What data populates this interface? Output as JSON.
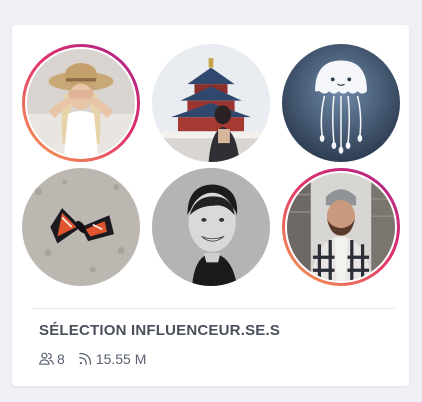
{
  "card": {
    "title": "SÉLECTION INFLUENCEUR.SE.S",
    "stats": {
      "members_icon": "users-icon",
      "members_count": "8",
      "audience_icon": "rss-icon",
      "audience_value": "15.55 M"
    }
  },
  "avatars": [
    {
      "name": "influencer-avatar-straw-hat",
      "story_ring": true
    },
    {
      "name": "influencer-avatar-temple",
      "story_ring": false
    },
    {
      "name": "influencer-avatar-jellyfish",
      "story_ring": false
    },
    {
      "name": "influencer-avatar-moth",
      "story_ring": false
    },
    {
      "name": "influencer-avatar-smiling-man",
      "story_ring": false
    },
    {
      "name": "influencer-avatar-beanie-man",
      "story_ring": true
    }
  ],
  "colors": {
    "page_background": "#eef0f5",
    "card_background": "#ffffff",
    "title_text": "#4a4f5c",
    "story_ring_gradient": [
      "#f6a34c",
      "#e1306c",
      "#a6248c"
    ]
  }
}
